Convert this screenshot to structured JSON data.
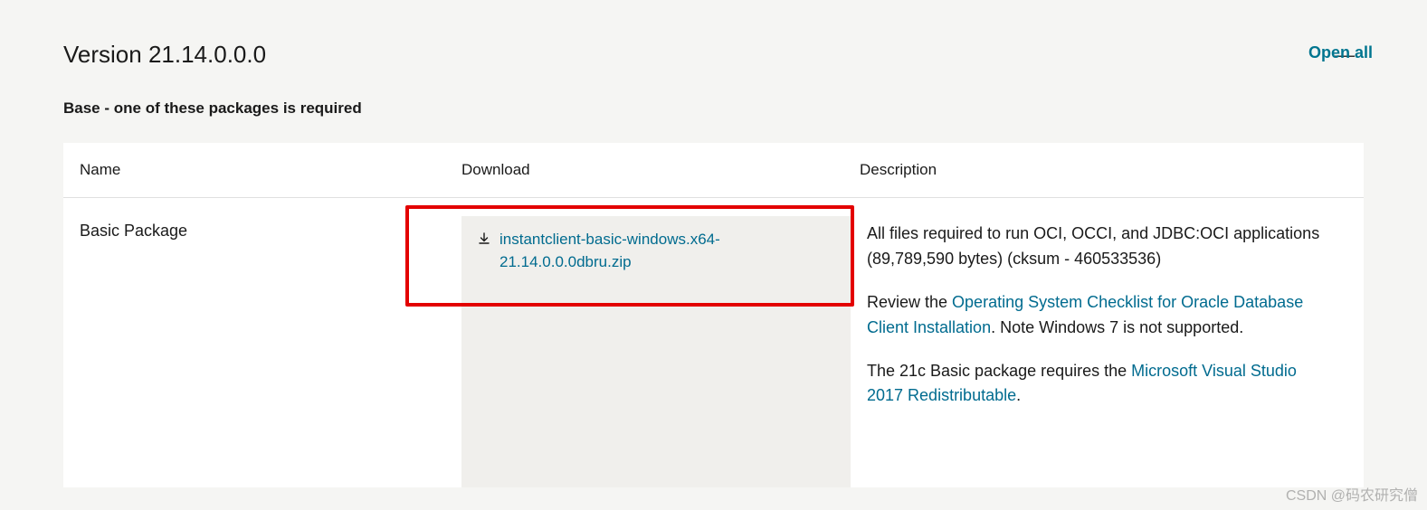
{
  "open_all_label": "Open all",
  "version_title": "Version 21.14.0.0.0",
  "subtitle": "Base - one of these packages is required",
  "columns": {
    "name": "Name",
    "download": "Download",
    "description": "Description"
  },
  "row": {
    "name": "Basic Package",
    "download_filename": "instantclient-basic-windows.x64-21.14.0.0.0dbru.zip",
    "desc_line1": "All files required to run OCI, OCCI, and JDBC:OCI applications",
    "desc_meta": "(89,789,590 bytes) (cksum - 460533536)",
    "desc_review_prefix": "Review the ",
    "desc_review_link": "Operating System Checklist for Oracle Database Client Installation",
    "desc_review_suffix": ". Note Windows 7 is not supported.",
    "desc_21c_prefix": "The 21c Basic package requires the ",
    "desc_21c_link": "Microsoft Visual Studio 2017 Redistributable",
    "desc_21c_suffix": "."
  },
  "watermark": "CSDN @码农研究僧"
}
